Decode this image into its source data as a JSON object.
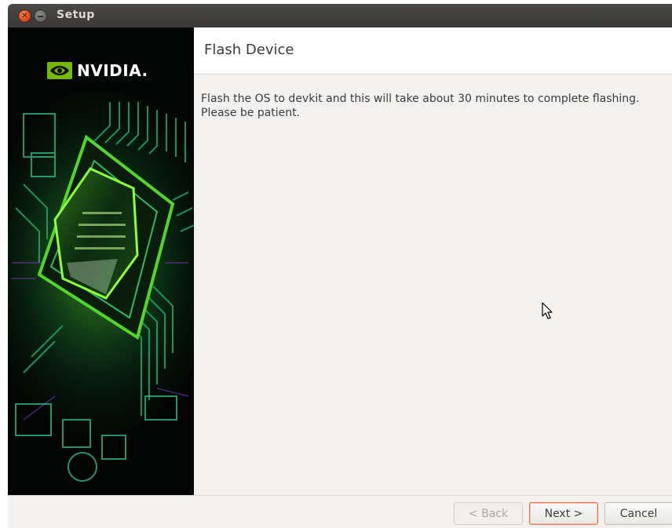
{
  "window": {
    "title": "Setup",
    "buttons": [
      "close-icon",
      "minimize-icon"
    ]
  },
  "banner": {
    "brand": "NVIDIA."
  },
  "header": {
    "title": "Flash Device"
  },
  "content": {
    "line1": "Flash the OS to devkit and this will take about 30 minutes to complete flashing.",
    "line2": "Please be patient."
  },
  "footer": {
    "back_label": "< Back",
    "next_label": "Next >",
    "cancel_label": "Cancel"
  },
  "colors": {
    "accent": "#76b900",
    "close": "#dd4814",
    "focus": "#e8734a"
  }
}
